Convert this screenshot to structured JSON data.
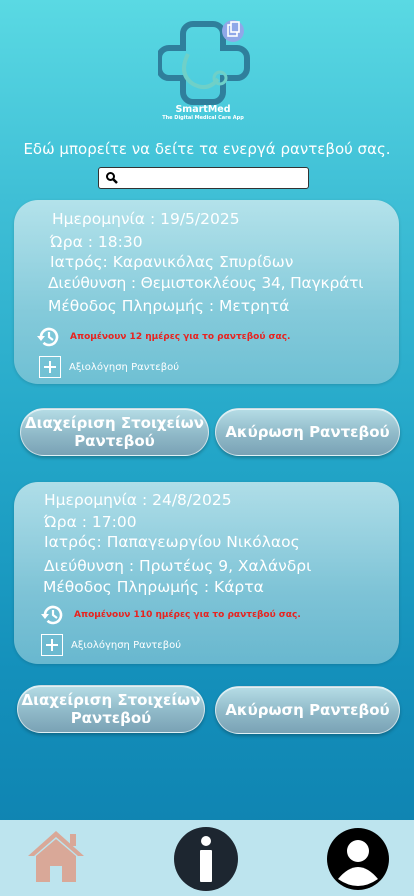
{
  "brand": {
    "name": "SmartMed",
    "tagline": "The Digital Medical Care App"
  },
  "intro_text": "Εδώ μπορείτε να δείτε τα ενεργά ραντεβού σας.",
  "search": {
    "placeholder": "",
    "value": ""
  },
  "appointments": [
    {
      "date": "Ημερομηνία :  19/5/2025",
      "time": "Ώρα : 18:30",
      "doctor": "Ιατρός: Καρανικόλας Σπυρίδων",
      "address": "Διεύθυνση : Θεμιστοκλέους 34, Παγκράτι",
      "payment": "Μέθοδος Πληρωμής : Μετρητά",
      "remaining": "Απομένουν 12 ημέρες για το ραντεβού σας.",
      "rate_label": "Αξιολόγηση Ραντεβού",
      "manage_label": "Διαχείριση Στοιχείων Ραντεβού",
      "cancel_label": "Ακύρωση Ραντεβού"
    },
    {
      "date": "Ημερομηνία :  24/8/2025",
      "time": "Ώρα : 17:00",
      "doctor": "Ιατρός: Παπαγεωργίου Νικόλαος",
      "address": "Διεύθυνση : Πρωτέως 9, Χαλάνδρι",
      "payment": "Μέθοδος Πληρωμής : Κάρτα",
      "remaining": "Απομένουν 110 ημέρες για το ραντεβού σας.",
      "rate_label": "Αξιολόγηση Ραντεβού",
      "manage_label": "Διαχείριση Στοιχείων Ραντεβού",
      "cancel_label": "Ακύρωση Ραντεβού"
    }
  ],
  "nav": {
    "home_icon": "home-icon",
    "info_icon": "info-icon",
    "profile_icon": "profile-icon"
  },
  "colors": {
    "warning_text": "#e8231f",
    "nav_bar": "#bde4ee",
    "home_icon": "#d9a898"
  }
}
